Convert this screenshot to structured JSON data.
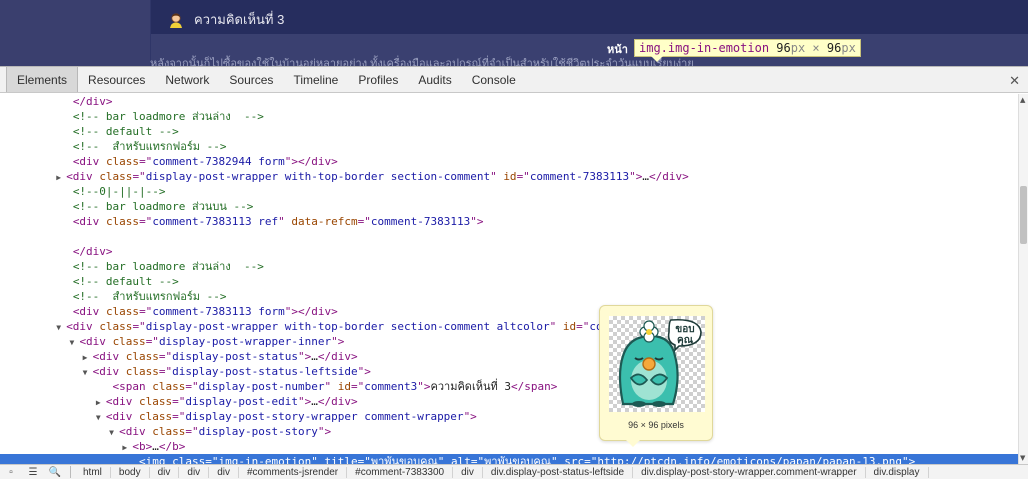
{
  "page": {
    "comment_title": "ความคิดเห็นที่ 3",
    "partial_heading": "หน้า",
    "ghost_text": "หลังจากนั้นก็ไปซื้อของใช้ในบ้านอยู่หลายอย่าง ทั้งเครื่องมือและอุปกรณ์ที่จำเป็นสำหรับใช้ชีวิตประจำวันแบบเรียบง่าย"
  },
  "hover_tooltip": {
    "selector": "img.img-in-emotion",
    "width": "96",
    "height": "96",
    "unit": "px",
    "times": "×"
  },
  "tabs": [
    "Elements",
    "Resources",
    "Network",
    "Sources",
    "Timeline",
    "Profiles",
    "Audits",
    "Console"
  ],
  "active_tab": "Elements",
  "close_glyph": "✕",
  "code_lines": [
    {
      "indent": 11,
      "tri": "",
      "parts": [
        [
          "tag",
          "</div>"
        ]
      ]
    },
    {
      "indent": 11,
      "tri": "",
      "parts": [
        [
          "cm",
          "<!-- bar loadmore ส่วนล่าง  -->"
        ]
      ]
    },
    {
      "indent": 11,
      "tri": "",
      "parts": [
        [
          "cm",
          "<!-- default -->"
        ]
      ]
    },
    {
      "indent": 11,
      "tri": "",
      "parts": [
        [
          "cm",
          "<!--  สำหรับแทรกฟอร์ม -->"
        ]
      ]
    },
    {
      "indent": 11,
      "tri": "",
      "parts": [
        [
          "tag",
          "<div "
        ],
        [
          "an",
          "class"
        ],
        [
          "tag",
          "=\""
        ],
        [
          "av",
          "comment-7382944 form"
        ],
        [
          "tag",
          "\"></div>"
        ]
      ]
    },
    {
      "indent": 10,
      "tri": "▶",
      "parts": [
        [
          "tag",
          "<div "
        ],
        [
          "an",
          "class"
        ],
        [
          "tag",
          "=\""
        ],
        [
          "av",
          "display-post-wrapper with-top-border section-comment"
        ],
        [
          "tag",
          "\" "
        ],
        [
          "an",
          "id"
        ],
        [
          "tag",
          "=\""
        ],
        [
          "av",
          "comment-7383113"
        ],
        [
          "tag",
          "\">"
        ],
        [
          "tx",
          "…"
        ],
        [
          "tag",
          "</div>"
        ]
      ]
    },
    {
      "indent": 11,
      "tri": "",
      "parts": [
        [
          "cm",
          "<!--0|-||-|-->"
        ]
      ]
    },
    {
      "indent": 11,
      "tri": "",
      "parts": [
        [
          "cm",
          "<!-- bar loadmore ส่วนบน -->"
        ]
      ]
    },
    {
      "indent": 11,
      "tri": "",
      "parts": [
        [
          "tag",
          "<div "
        ],
        [
          "an",
          "class"
        ],
        [
          "tag",
          "=\""
        ],
        [
          "av",
          "comment-7383113 ref"
        ],
        [
          "tag",
          "\" "
        ],
        [
          "an",
          "data-refcm"
        ],
        [
          "tag",
          "=\""
        ],
        [
          "av",
          "comment-7383113"
        ],
        [
          "tag",
          "\">"
        ]
      ]
    },
    {
      "indent": 11,
      "tri": "",
      "parts": [
        [
          "tx",
          ""
        ]
      ]
    },
    {
      "indent": 11,
      "tri": "",
      "parts": [
        [
          "tag",
          "</div>"
        ]
      ]
    },
    {
      "indent": 11,
      "tri": "",
      "parts": [
        [
          "cm",
          "<!-- bar loadmore ส่วนล่าง  -->"
        ]
      ]
    },
    {
      "indent": 11,
      "tri": "",
      "parts": [
        [
          "cm",
          "<!-- default -->"
        ]
      ]
    },
    {
      "indent": 11,
      "tri": "",
      "parts": [
        [
          "cm",
          "<!--  สำหรับแทรกฟอร์ม -->"
        ]
      ]
    },
    {
      "indent": 11,
      "tri": "",
      "parts": [
        [
          "tag",
          "<div "
        ],
        [
          "an",
          "class"
        ],
        [
          "tag",
          "=\""
        ],
        [
          "av",
          "comment-7383113 form"
        ],
        [
          "tag",
          "\"></div>"
        ]
      ]
    },
    {
      "indent": 10,
      "tri": "▼",
      "parts": [
        [
          "tag",
          "<div "
        ],
        [
          "an",
          "class"
        ],
        [
          "tag",
          "=\""
        ],
        [
          "av",
          "display-post-wrapper with-top-border section-comment altcolor"
        ],
        [
          "tag",
          "\" "
        ],
        [
          "an",
          "id"
        ],
        [
          "tag",
          "=\""
        ],
        [
          "av",
          "comment-7383300"
        ],
        [
          "tag",
          "\">"
        ]
      ]
    },
    {
      "indent": 12,
      "tri": "▼",
      "parts": [
        [
          "tag",
          "<div "
        ],
        [
          "an",
          "class"
        ],
        [
          "tag",
          "=\""
        ],
        [
          "av",
          "display-post-wrapper-inner"
        ],
        [
          "tag",
          "\">"
        ]
      ]
    },
    {
      "indent": 14,
      "tri": "▶",
      "parts": [
        [
          "tag",
          "<div "
        ],
        [
          "an",
          "class"
        ],
        [
          "tag",
          "=\""
        ],
        [
          "av",
          "display-post-status"
        ],
        [
          "tag",
          "\">"
        ],
        [
          "tx",
          "…"
        ],
        [
          "tag",
          "</div>"
        ]
      ]
    },
    {
      "indent": 14,
      "tri": "▼",
      "parts": [
        [
          "tag",
          "<div "
        ],
        [
          "an",
          "class"
        ],
        [
          "tag",
          "=\""
        ],
        [
          "av",
          "display-post-status-leftside"
        ],
        [
          "tag",
          "\">"
        ]
      ]
    },
    {
      "indent": 17,
      "tri": "",
      "parts": [
        [
          "tag",
          "<span "
        ],
        [
          "an",
          "class"
        ],
        [
          "tag",
          "=\""
        ],
        [
          "av",
          "display-post-number"
        ],
        [
          "tag",
          "\" "
        ],
        [
          "an",
          "id"
        ],
        [
          "tag",
          "=\""
        ],
        [
          "av",
          "comment3"
        ],
        [
          "tag",
          "\">"
        ],
        [
          "tx",
          "ความคิดเห็นที่ 3"
        ],
        [
          "tag",
          "</span>"
        ]
      ]
    },
    {
      "indent": 16,
      "tri": "▶",
      "parts": [
        [
          "tag",
          "<div "
        ],
        [
          "an",
          "class"
        ],
        [
          "tag",
          "=\""
        ],
        [
          "av",
          "display-post-edit"
        ],
        [
          "tag",
          "\">"
        ],
        [
          "tx",
          "…"
        ],
        [
          "tag",
          "</div>"
        ]
      ]
    },
    {
      "indent": 16,
      "tri": "▼",
      "parts": [
        [
          "tag",
          "<div "
        ],
        [
          "an",
          "class"
        ],
        [
          "tag",
          "=\""
        ],
        [
          "av",
          "display-post-story-wrapper comment-wrapper"
        ],
        [
          "tag",
          "\">"
        ]
      ]
    },
    {
      "indent": 18,
      "tri": "▼",
      "parts": [
        [
          "tag",
          "<div "
        ],
        [
          "an",
          "class"
        ],
        [
          "tag",
          "=\""
        ],
        [
          "av",
          "display-post-story"
        ],
        [
          "tag",
          "\">"
        ]
      ]
    },
    {
      "indent": 20,
      "tri": "▶",
      "parts": [
        [
          "tag",
          "<b>"
        ],
        [
          "tx",
          "…"
        ],
        [
          "tag",
          "</b>"
        ]
      ]
    },
    {
      "indent": 21,
      "tri": "",
      "highlight": true,
      "parts": [
        [
          "tag",
          "<img "
        ],
        [
          "an",
          "class"
        ],
        [
          "tag",
          "=\""
        ],
        [
          "av",
          "img-in-emotion"
        ],
        [
          "tag",
          "\" "
        ],
        [
          "an",
          "title"
        ],
        [
          "tag",
          "=\""
        ],
        [
          "av",
          "พาพันขอบคุณ"
        ],
        [
          "tag",
          "\" "
        ],
        [
          "an",
          "alt"
        ],
        [
          "tag",
          "=\""
        ],
        [
          "av",
          "พาพันขอบคุณ"
        ],
        [
          "tag",
          "\" "
        ],
        [
          "an",
          "src"
        ],
        [
          "tag",
          "=\""
        ],
        [
          "link",
          "http://ptcdn.info/emoticons/papan/papan-13.png"
        ],
        [
          "tag",
          "\">"
        ]
      ]
    }
  ],
  "preview": {
    "dims_label": "96 × 96 pixels",
    "sticker_text_1": "ขอบ",
    "sticker_text_2": "คุณ"
  },
  "breadcrumbs": [
    "html",
    "body",
    "div",
    "div",
    "div",
    "#comments-jsrender",
    "#comment-7383300",
    "div",
    "div.display-post-status-leftside",
    "div.display-post-story-wrapper.comment-wrapper",
    "div.display"
  ],
  "bottom_tools": [
    "▫",
    "☰",
    "🔍"
  ],
  "colors": {
    "page_bg": "#2f3668",
    "selection": "#3875d7",
    "tag": "#881280",
    "attr_name": "#994500",
    "attr_value": "#1a1aa6",
    "comment": "#236e25"
  }
}
